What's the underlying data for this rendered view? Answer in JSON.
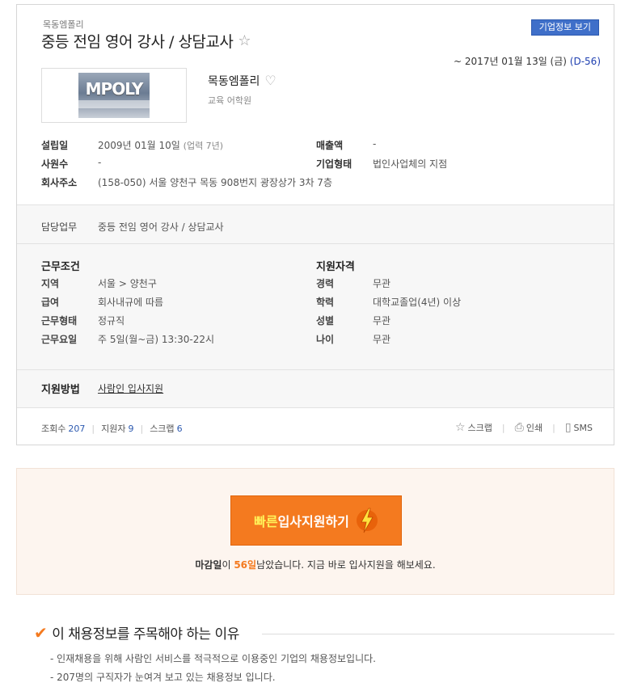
{
  "header": {
    "company_small": "목동엠폴리",
    "job_title": "중등 전임 영어 강사 / 상담교사",
    "company_info_button": "기업정보 보기",
    "deadline_prefix": "~ 2017년 01월 13일 (금)",
    "dday": "(D-56)"
  },
  "company": {
    "logo_text": "MPOLY",
    "name": "목동엠폴리",
    "type": "교육 어학원",
    "founded_label": "설립일",
    "founded_value": "2009년 01월 10일",
    "founded_sub": "(업력 7년)",
    "sales_label": "매출액",
    "sales_value": "-",
    "employees_label": "사원수",
    "employees_value": "-",
    "form_label": "기업형태",
    "form_value": "법인사업체의 지점",
    "address_label": "회사주소",
    "address_value": "(158-050) 서울 양천구 목동 908번지 광장상가 3차 7층"
  },
  "duty": {
    "label": "담당업무",
    "value": "중등 전임 영어 강사 / 상담교사"
  },
  "conditions": {
    "title": "근무조건",
    "rows": [
      {
        "label": "지역",
        "value": "서울 > 양천구"
      },
      {
        "label": "급여",
        "value": "회사내규에 따름"
      },
      {
        "label": "근무형태",
        "value": "정규직"
      },
      {
        "label": "근무요일",
        "value": "주 5일(월~금) 13:30-22시"
      }
    ]
  },
  "qualifications": {
    "title": "지원자격",
    "rows": [
      {
        "label": "경력",
        "value": "무관"
      },
      {
        "label": "학력",
        "value": "대학교졸업(4년) 이상"
      },
      {
        "label": "성별",
        "value": "무관"
      },
      {
        "label": "나이",
        "value": "무관"
      }
    ]
  },
  "apply_method": {
    "label": "지원방법",
    "link": "사람인 입사지원"
  },
  "stats": {
    "views_label": "조회수",
    "views": "207",
    "applicants_label": "지원자",
    "applicants": "9",
    "scraps_label": "스크랩",
    "scraps": "6"
  },
  "actions": {
    "scrap": "스크랩",
    "print": "인쇄",
    "sms": "SMS"
  },
  "quick_apply": {
    "strong": "빠른",
    "text": "입사지원하기",
    "msg_prefix": "마감일",
    "msg_mid": "이 ",
    "days": "56일",
    "msg_suffix": "남았습니다. 지금 바로 입사지원을 해보세요."
  },
  "reasons": {
    "title": "이 채용정보를 주목해야 하는 이유",
    "items": [
      "- 인재채용을 위해 사람인 서비스를 적극적으로 이용중인 기업의 채용정보입니다.",
      "- 207명의 구직자가 눈여겨 보고 있는 채용정보 입니다."
    ]
  },
  "colors": {
    "accent": "#f47a1f",
    "link_blue": "#2d5ab0",
    "button_blue": "#3f6fc9"
  }
}
